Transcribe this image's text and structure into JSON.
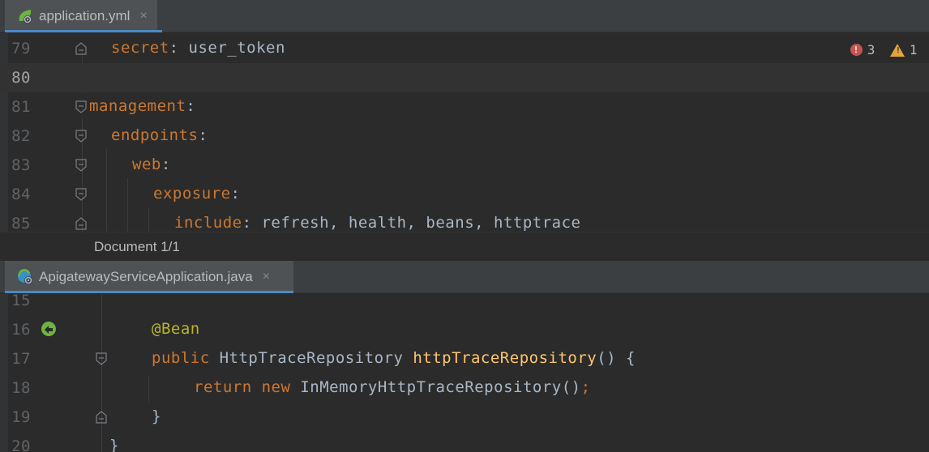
{
  "top_editor": {
    "tab": {
      "label": "application.yml",
      "close": "×"
    },
    "inspections": {
      "errors": "3",
      "warnings": "1"
    },
    "lines": [
      {
        "num": "79",
        "key": "secret",
        "sep": ":",
        "value": " user_token"
      },
      {
        "num": "80",
        "key": "",
        "sep": "",
        "value": ""
      },
      {
        "num": "81",
        "key": "management",
        "sep": ":",
        "value": ""
      },
      {
        "num": "82",
        "key": "endpoints",
        "sep": ":",
        "value": ""
      },
      {
        "num": "83",
        "key": "web",
        "sep": ":",
        "value": ""
      },
      {
        "num": "84",
        "key": "exposure",
        "sep": ":",
        "value": ""
      },
      {
        "num": "85",
        "key": "include",
        "sep": ":",
        "value": " refresh, health, beans, httptrace"
      }
    ],
    "breadcrumb": "Document 1/1"
  },
  "bottom_editor": {
    "tab": {
      "label": "ApigatewayServiceApplication.java",
      "close": "×"
    },
    "lines": [
      {
        "num": "15"
      },
      {
        "num": "16",
        "annotation": "@Bean"
      },
      {
        "num": "17",
        "kw": "public",
        "type": " HttpTraceRepository ",
        "fn": "httpTraceRepository",
        "rest": "() {"
      },
      {
        "num": "18",
        "kw": "return",
        "kw2": " new",
        "rest": " InMemoryHttpTraceRepository()",
        "semi": ";"
      },
      {
        "num": "19",
        "rest": "}"
      },
      {
        "num": "20",
        "rest": "}"
      }
    ]
  },
  "colors": {
    "background": "#2b2b2b",
    "yaml_key": "#cc7832",
    "annotation": "#bbb529",
    "function": "#ffc66d",
    "line_number": "#606366",
    "tab_active_underline": "#4a88c7"
  }
}
